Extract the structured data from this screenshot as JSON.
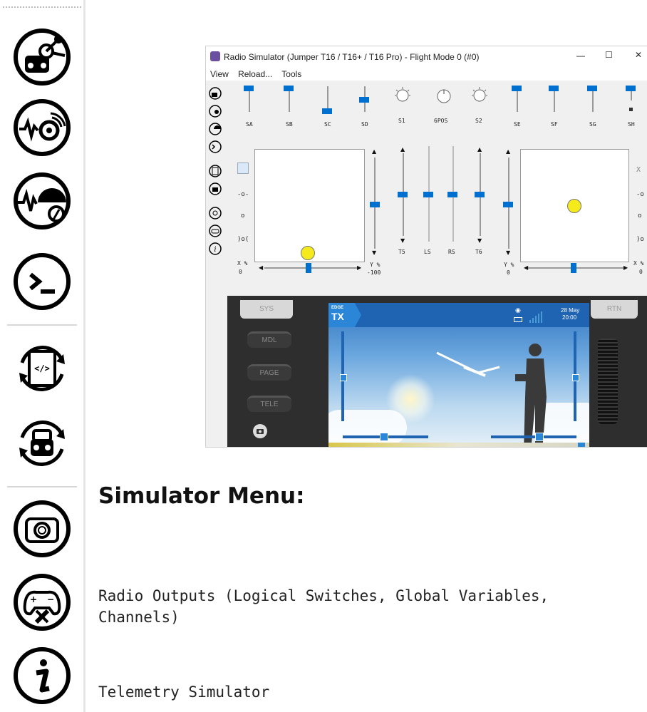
{
  "sidebar": {
    "icons": [
      "radio-controller-icon",
      "telemetry-eye-icon",
      "trainer-signal-icon",
      "terminal-icon",
      "lua-script-icon",
      "joystick-icon",
      "camera-icon",
      "gamepad-settings-icon",
      "info-icon"
    ]
  },
  "window": {
    "title": "Radio Simulator (Jumper T16 / T16+ / T16 Pro) - Flight Mode 0 (#0)",
    "min_label": "—",
    "max_label": "☐",
    "close_label": "✕",
    "menu": [
      "View",
      "Reload...",
      "Tools"
    ]
  },
  "switches": {
    "labels": [
      "SA",
      "SB",
      "SC",
      "SD",
      "S1",
      "6POS",
      "S2",
      "SE",
      "SF",
      "SG",
      "SH"
    ]
  },
  "sliders": {
    "labels": [
      "T5",
      "LS",
      "RS",
      "T6"
    ]
  },
  "readouts": {
    "left_x_label": "X %",
    "left_x_value": "0",
    "left_y_label": "Y %",
    "left_y_value": "-100",
    "right_y_label": "Y %",
    "right_y_value": "0",
    "right_x_label": "X %",
    "right_x_value": "0"
  },
  "radio": {
    "sys": "SYS",
    "mdl": "MDL",
    "page": "PAGE",
    "tele": "TELE",
    "rtn": "RTN",
    "logo_top": "EDGE",
    "logo_bottom": "TX",
    "date": "28 May",
    "time": "20:00"
  },
  "doc": {
    "heading": "Simulator Menu:",
    "line1": " Radio Outputs (Logical Switches, Global Variables,",
    "line2": "Channels)",
    "line3": "Telemetry Simulator"
  },
  "colors": {
    "accent": "#0070d0",
    "knob": "#f5ea1c"
  }
}
